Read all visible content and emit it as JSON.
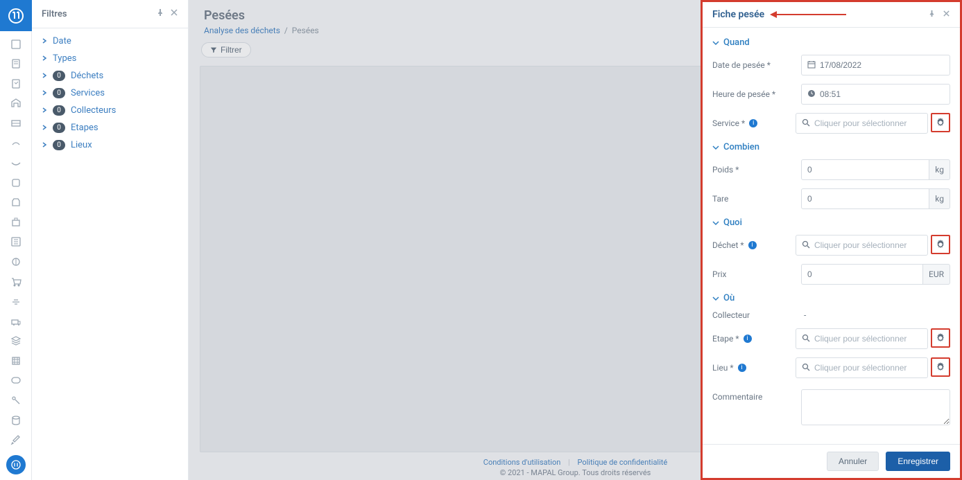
{
  "filters": {
    "title": "Filtres",
    "items": [
      {
        "label": "Date",
        "badge": null
      },
      {
        "label": "Types",
        "badge": null
      },
      {
        "label": "Déchets",
        "badge": "0"
      },
      {
        "label": "Services",
        "badge": "0"
      },
      {
        "label": "Collecteurs",
        "badge": "0"
      },
      {
        "label": "Etapes",
        "badge": "0"
      },
      {
        "label": "Lieux",
        "badge": "0"
      }
    ]
  },
  "page": {
    "title": "Pesées",
    "breadcrumb_root": "Analyse des déchets",
    "breadcrumb_current": "Pesées",
    "filter_button": "Filtrer"
  },
  "footer": {
    "terms": "Conditions d'utilisation",
    "privacy": "Politique de confidentialité",
    "copyright": "© 2021 - MAPAL Group. Tous droits réservés"
  },
  "panel": {
    "title": "Fiche pesée",
    "sections": {
      "quand": "Quand",
      "combien": "Combien",
      "quoi": "Quoi",
      "ou": "Où"
    },
    "fields": {
      "date_label": "Date de pesée *",
      "date_value": "17/08/2022",
      "heure_label": "Heure de pesée *",
      "heure_value": "08:51",
      "service_label": "Service *",
      "service_placeholder": "Cliquer pour sélectionner",
      "poids_label": "Poids *",
      "poids_value": "0",
      "poids_unit": "kg",
      "tare_label": "Tare",
      "tare_value": "0",
      "tare_unit": "kg",
      "dechet_label": "Déchet *",
      "dechet_placeholder": "Cliquer pour sélectionner",
      "prix_label": "Prix",
      "prix_value": "0",
      "prix_unit": "EUR",
      "collecteur_label": "Collecteur",
      "collecteur_value": "-",
      "etape_label": "Etape *",
      "etape_placeholder": "Cliquer pour sélectionner",
      "lieu_label": "Lieu *",
      "lieu_placeholder": "Cliquer pour sélectionner",
      "comment_label": "Commentaire"
    },
    "buttons": {
      "cancel": "Annuler",
      "save": "Enregistrer"
    }
  }
}
